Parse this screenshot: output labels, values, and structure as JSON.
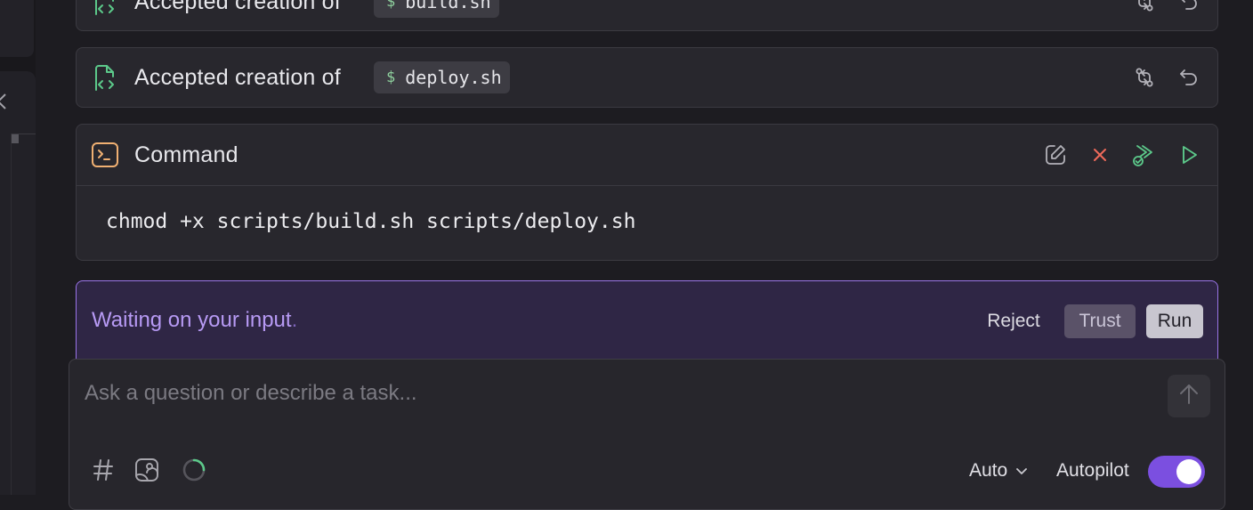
{
  "cards": {
    "build": {
      "title": "Accepted creation of",
      "filename": "build.sh",
      "dollar": "$"
    },
    "deploy": {
      "title": "Accepted creation of",
      "filename": "deploy.sh",
      "dollar": "$"
    },
    "command": {
      "title": "Command",
      "text": "chmod +x scripts/build.sh scripts/deploy.sh"
    }
  },
  "waiting": {
    "message": "Waiting on your input",
    "dot": ".",
    "reject_label": "Reject",
    "trust_label": "Trust",
    "run_label": "Run"
  },
  "composer": {
    "placeholder": "Ask a question or describe a task...",
    "mode": "Auto",
    "autopilot_label": "Autopilot",
    "autopilot_on": true
  },
  "icons": {
    "file_code": "file-code-icon",
    "terminal": "terminal-icon",
    "compare": "compare-icon",
    "undo": "undo-icon",
    "edit": "edit-icon",
    "close": "close-icon",
    "run_all": "run-all-icon",
    "play": "play-icon",
    "hash": "hash-icon",
    "image": "image-icon",
    "spinner": "spinner-icon",
    "arrow_up": "arrow-up-icon",
    "chevron_down": "chevron-down-icon"
  },
  "colors": {
    "accent": "#7b4fe0",
    "waiting_border": "#9a74e8",
    "waiting_text": "#b79af4",
    "success_icon": "#5cc98a",
    "terminal_icon": "#f0b072",
    "danger": "#ee6a5a"
  }
}
